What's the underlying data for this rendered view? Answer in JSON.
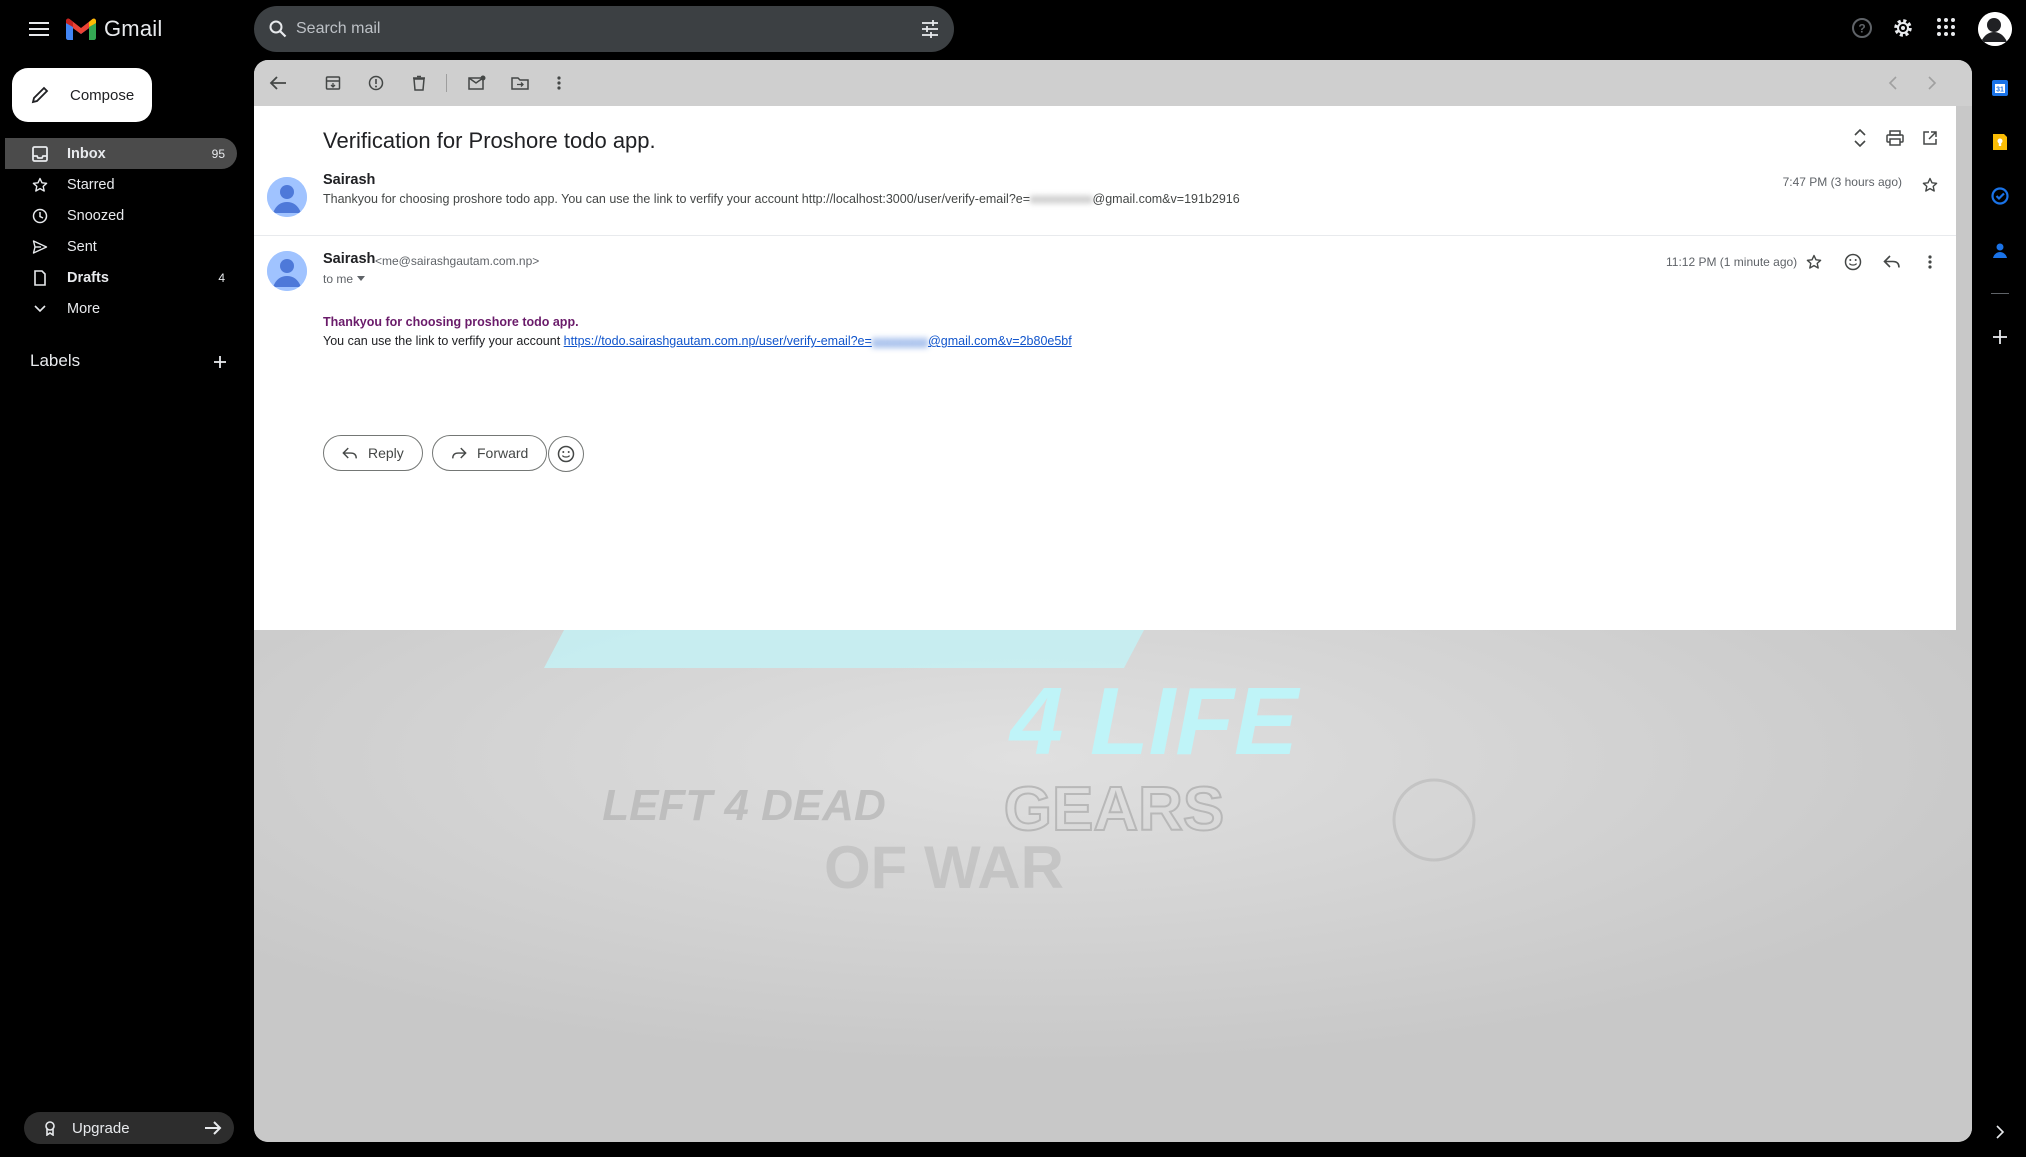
{
  "app": {
    "name": "Gmail"
  },
  "search": {
    "placeholder": "Search mail"
  },
  "compose": {
    "label": "Compose"
  },
  "sidebar": {
    "items": [
      {
        "label": "Inbox",
        "count": "95",
        "icon": "inbox-icon"
      },
      {
        "label": "Starred",
        "count": "",
        "icon": "star-icon"
      },
      {
        "label": "Snoozed",
        "count": "",
        "icon": "clock-icon"
      },
      {
        "label": "Sent",
        "count": "",
        "icon": "send-icon"
      },
      {
        "label": "Drafts",
        "count": "4",
        "icon": "draft-icon"
      },
      {
        "label": "More",
        "count": "",
        "icon": "chevron-down-icon"
      }
    ],
    "labels_heading": "Labels",
    "upgrade_label": "Upgrade"
  },
  "thread": {
    "subject": "Verification for Proshore todo app.",
    "messages": [
      {
        "sender": "Sairash",
        "snippet": "Thankyou for choosing proshore todo app. You can use the link to verfify your account http://localhost:3000/user/verify-email?e=",
        "snippet_redacted": "xxxxxxxxxx",
        "snippet_tail": "@gmail.com&v=191b2916",
        "time": "7:47 PM (3 hours ago)"
      },
      {
        "sender": "Sairash",
        "email": "<me@sairashgautam.com.np>",
        "to": "to me",
        "time": "11:12 PM (1 minute ago)",
        "body_line1": "Thankyou for choosing proshore todo app.",
        "body_line2": "You can use the link to verfify your account",
        "link_prefix": "https://todo.sairashgautam.com.np/user/verify-email?e=",
        "link_redacted": "xxxxxxxxx",
        "link_suffix": "@gmail.com&v=2b80e5bf"
      }
    ],
    "actions": {
      "reply": "Reply",
      "forward": "Forward"
    }
  },
  "wallpaper": {
    "text_main": "4 LIFE",
    "text_left": "LEFT 4 DEAD",
    "text_right": "GEARS",
    "text_bottom": "OF WAR"
  },
  "colors": {
    "background": "#000000",
    "search_bg": "#3c4043",
    "active_nav": "#4b4b4b",
    "main_frame": "#c8c8c8",
    "link": "#1155cc",
    "body_heading": "#6a1b6a",
    "wallpaper_accent": "#bff4f8"
  }
}
